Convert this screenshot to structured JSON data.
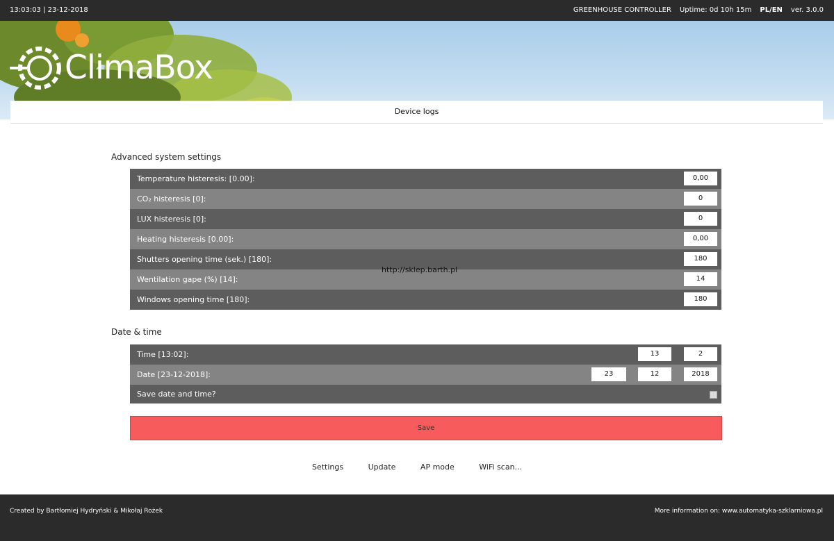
{
  "topbar": {
    "time_date": "13:03:03 | 23-12-2018",
    "title": "GREENHOUSE CONTROLLER",
    "uptime": "Uptime: 0d 10h 15m",
    "lang": "PL/EN",
    "version": "ver. 3.0.0"
  },
  "banner": {
    "logo_text": "ClimaBox"
  },
  "subnav": {
    "label": "Device logs"
  },
  "advanced": {
    "title": "Advanced system settings",
    "rows": [
      {
        "label": "Temperature histeresis: [0.00]:",
        "value": "0,00"
      },
      {
        "label": "CO₂ histeresis [0]:",
        "value": "0"
      },
      {
        "label": "LUX histeresis [0]:",
        "value": "0"
      },
      {
        "label": "Heating histeresis [0.00]:",
        "value": "0,00"
      },
      {
        "label": "Shutters opening time (sek.) [180]:",
        "value": "180"
      },
      {
        "label": "Wentilation gape (%) [14]:",
        "value": "14"
      },
      {
        "label": "Windows opening time [180]:",
        "value": "180"
      }
    ]
  },
  "watermark": "http://sklep.barth.pl",
  "datetime": {
    "title": "Date & time",
    "time_label": "Time [13:02]:",
    "time_h": "13",
    "time_m": "2",
    "date_label": "Date [23-12-2018]:",
    "date_d": "23",
    "date_m": "12",
    "date_y": "2018",
    "save_label": "Save date and time?"
  },
  "save_button": "Save",
  "links": [
    "Settings",
    "Update",
    "AP mode",
    "WiFi scan..."
  ],
  "footer": {
    "left": "Created by Bartłomiej Hydryński & Mikołaj Rożek",
    "right": "More information on: www.automatyka-szklarniowa.pl"
  },
  "colors": {
    "save": "#f85b5b",
    "dark_row": "#5d5d5d",
    "light_row": "#848484",
    "bar": "#2b2b2b"
  }
}
